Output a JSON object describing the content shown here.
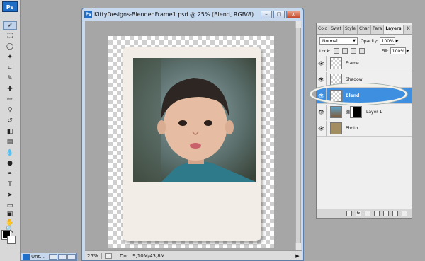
{
  "toolbar": {
    "app_logo": "Ps"
  },
  "document": {
    "title": "KittyDesigns-BlendedFrame1.psd @ 25% (Blend, RGB/8)",
    "zoom": "25%",
    "doc_info": "Doc: 9,10M/43,8M",
    "buttons": [
      "–",
      "□",
      "x"
    ]
  },
  "minimized_doc": {
    "title": "Unt..."
  },
  "layers_panel": {
    "tabs": [
      "Colo",
      "Swat",
      "Style",
      "Char",
      "Para",
      "Layers"
    ],
    "active_tab": "Layers",
    "close": "x",
    "blend_mode": "Normal",
    "opacity_label": "Opacity:",
    "opacity": "100%",
    "lock_label": "Lock:",
    "fill_label": "Fill:",
    "fill": "100%",
    "layers": [
      {
        "name": "Frame",
        "thumb": "checker",
        "selected": false
      },
      {
        "name": "Shadow",
        "thumb": "checker",
        "selected": false
      },
      {
        "name": "Blend",
        "thumb": "checker",
        "selected": true
      },
      {
        "name": "Layer 1",
        "thumb": "photo",
        "selected": false
      },
      {
        "name": "Photo",
        "thumb": "tan",
        "selected": false
      }
    ]
  },
  "colors": {
    "accent": "#3f8fe0",
    "window_chrome": "#c7d9ee",
    "foreground": "#000000",
    "background": "#ffffff"
  }
}
